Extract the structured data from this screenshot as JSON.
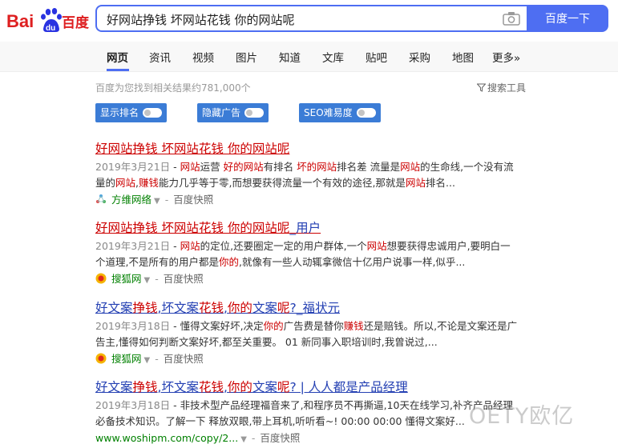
{
  "logo": {
    "left": "Bai",
    "badge": "du",
    "right": "百度"
  },
  "search": {
    "query": "好网站挣钱 坏网站花钱 你的网站呢",
    "button": "百度一下"
  },
  "tabs": [
    {
      "label": "网页",
      "active": true
    },
    {
      "label": "资讯"
    },
    {
      "label": "视频"
    },
    {
      "label": "图片"
    },
    {
      "label": "知道"
    },
    {
      "label": "文库"
    },
    {
      "label": "贴吧"
    },
    {
      "label": "采购"
    },
    {
      "label": "地图"
    },
    {
      "label": "更多»"
    }
  ],
  "toolbar": {
    "result_count": "百度为您找到相关结果约781,000个",
    "search_tools": "搜索工具",
    "toggles": [
      "显示排名",
      "隐藏广告",
      "SEO难易度"
    ]
  },
  "results": [
    {
      "title_parts": [
        "好网站挣钱 坏网站花钱 你的网站呢"
      ],
      "date": "2019年3月21日",
      "snippet_line1": [
        "- ",
        "网站",
        "运营 ",
        "好的网站",
        "有排名 ",
        "坏的网站",
        "排名差 流量是",
        "网站",
        "的生命线,一个没有流"
      ],
      "snippet_line2": [
        "量的",
        "网站",
        ",",
        "赚钱",
        "能力几乎等于零,而想要获得流量一个有效的途径,那就是",
        "网站",
        "排名..."
      ],
      "source": "方维网络",
      "snapshot": "百度快照"
    },
    {
      "title_parts": [
        "好网站挣钱 坏网站花钱 你的网站呢",
        "_用户"
      ],
      "date": "2019年3月21日",
      "snippet_line1": [
        "- ",
        "网站",
        "的定位,还要圈定一定的用户群体,一个",
        "网站",
        "想要获得忠诚用户,要明白一"
      ],
      "snippet_line2": [
        "个道理,不是所有的用户都是",
        "你的",
        ",就像有一些人动辄拿微信十亿用户说事一样,似乎..."
      ],
      "source": "搜狐网",
      "snapshot": "百度快照"
    },
    {
      "title_parts": [
        "好文案",
        "挣钱",
        ",坏文案",
        "花钱",
        ",",
        "你的",
        "文案",
        "呢",
        "?_福状元"
      ],
      "date": "2019年3月18日",
      "snippet_line1": [
        "- 懂得文案好坏,决定",
        "你的",
        "广告费是替你",
        "赚钱",
        "还是赔钱。所以,不论是文案还是广"
      ],
      "snippet_line2": [
        "告主,懂得如何判断文案好坏,都至关重要。 01 新同事入职培训时,我曾说过,..."
      ],
      "source": "搜狐网",
      "snapshot": "百度快照"
    },
    {
      "title_parts": [
        "好文案",
        "挣钱",
        ",坏文案",
        "花钱",
        ",",
        "你的",
        "文案",
        "呢",
        "? | 人人都是产品经理"
      ],
      "date": "2019年3月18日",
      "snippet_line1": [
        "- 非技术型产品经理福音来了,和程序员不再撕逼,10天在线学习,补齐产品经理"
      ],
      "snippet_line2": [
        "必备技术知识。了解一下 释放双眼,带上耳机,听听看~! 00:00 00:00 懂得文案好..."
      ],
      "source": "www.woshipm.com/copy/2...",
      "snapshot": "百度快照"
    }
  ],
  "watermark": "OETY欧亿",
  "colors": {
    "accent": "#4e6ef2",
    "highlight": "#cc0000",
    "link": "#2440b3",
    "source": "#008000"
  }
}
